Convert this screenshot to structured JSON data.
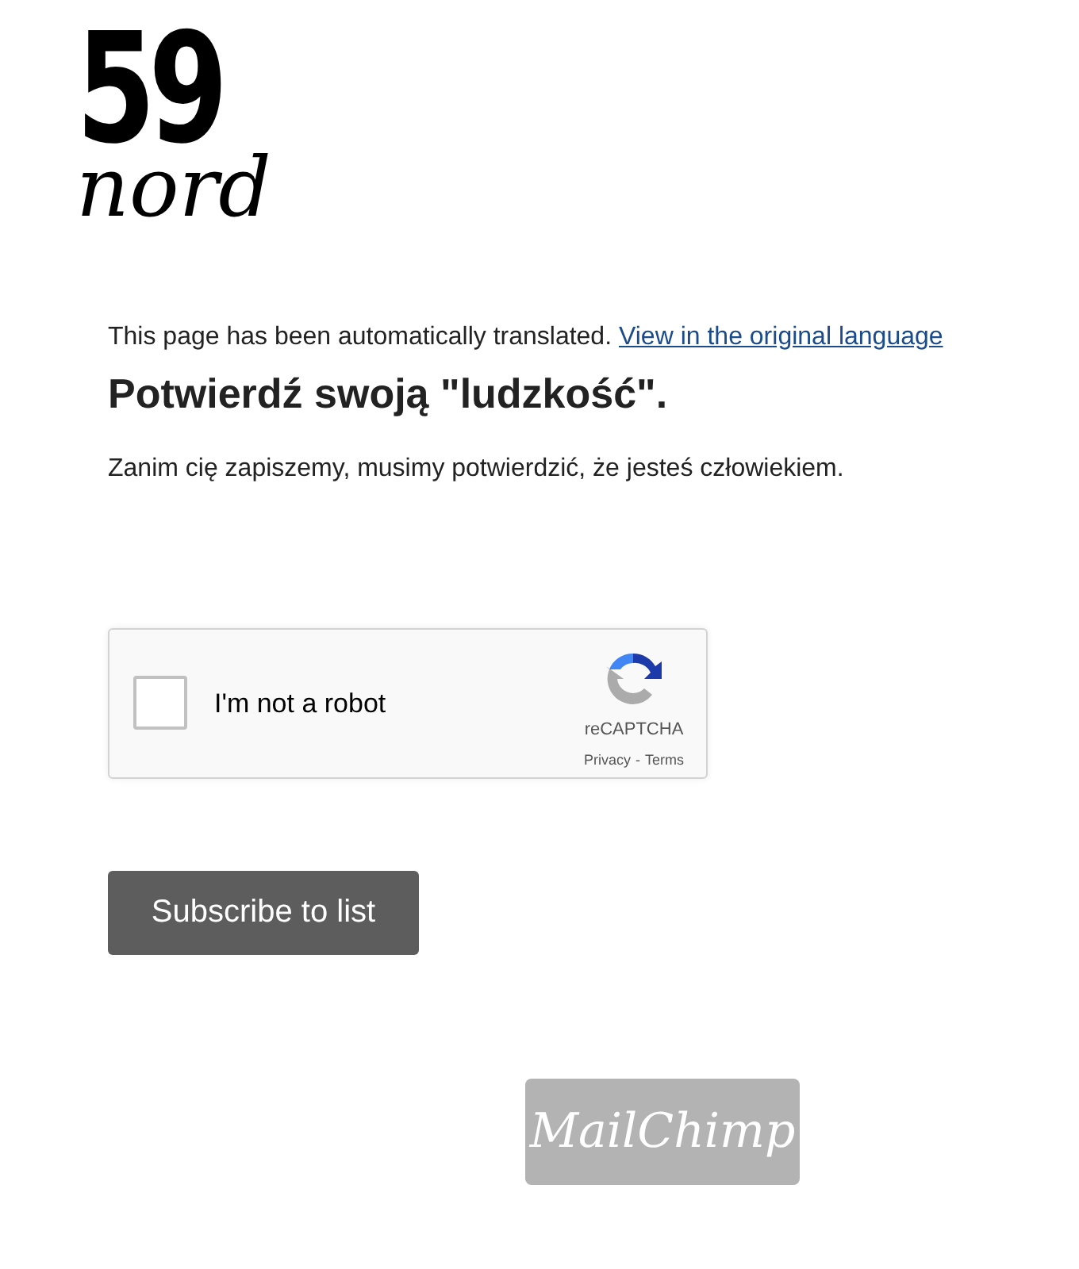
{
  "logo": {
    "number": "59",
    "word": "nord"
  },
  "translation_notice": {
    "text": "This page has been automatically translated.",
    "link": "View in the original language"
  },
  "heading": "Potwierdź swoją \"ludzkość\".",
  "description": "Zanim cię zapiszemy, musimy potwierdzić, że jesteś człowiekiem.",
  "captcha": {
    "checked": false,
    "label": "I'm not a robot",
    "brand": "reCAPTCHA",
    "privacy": "Privacy",
    "separator": "-",
    "terms": "Terms"
  },
  "submit_button": "Subscribe to list",
  "footer_badge": "MailChimp"
}
